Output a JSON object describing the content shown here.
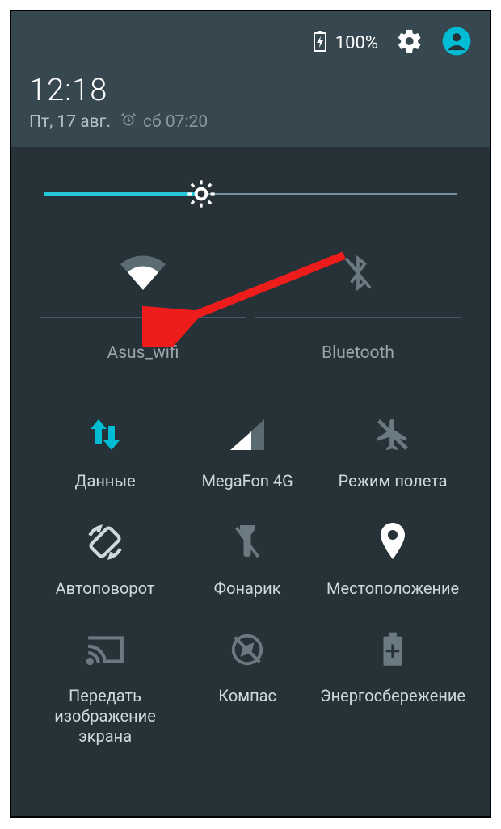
{
  "status": {
    "battery_pct": "100%"
  },
  "header": {
    "time": "12:18",
    "date": "Пт, 17 авг.",
    "alarm": "сб 07:20"
  },
  "brightness": {
    "value_pct": 38
  },
  "top_tiles": {
    "wifi": {
      "label": "Asus_wifi"
    },
    "bluetooth": {
      "label": "Bluetooth"
    }
  },
  "tiles": {
    "data": {
      "label": "Данные"
    },
    "signal": {
      "label": "MegaFon 4G"
    },
    "airplane": {
      "label": "Режим полета"
    },
    "rotate": {
      "label": "Автоповорот"
    },
    "flashlight": {
      "label": "Фонарик"
    },
    "location": {
      "label": "Местоположение"
    },
    "cast": {
      "label": "Передать изображение экрана"
    },
    "compass": {
      "label": "Компас"
    },
    "battery_saver": {
      "label": "Энергосбережение"
    }
  }
}
